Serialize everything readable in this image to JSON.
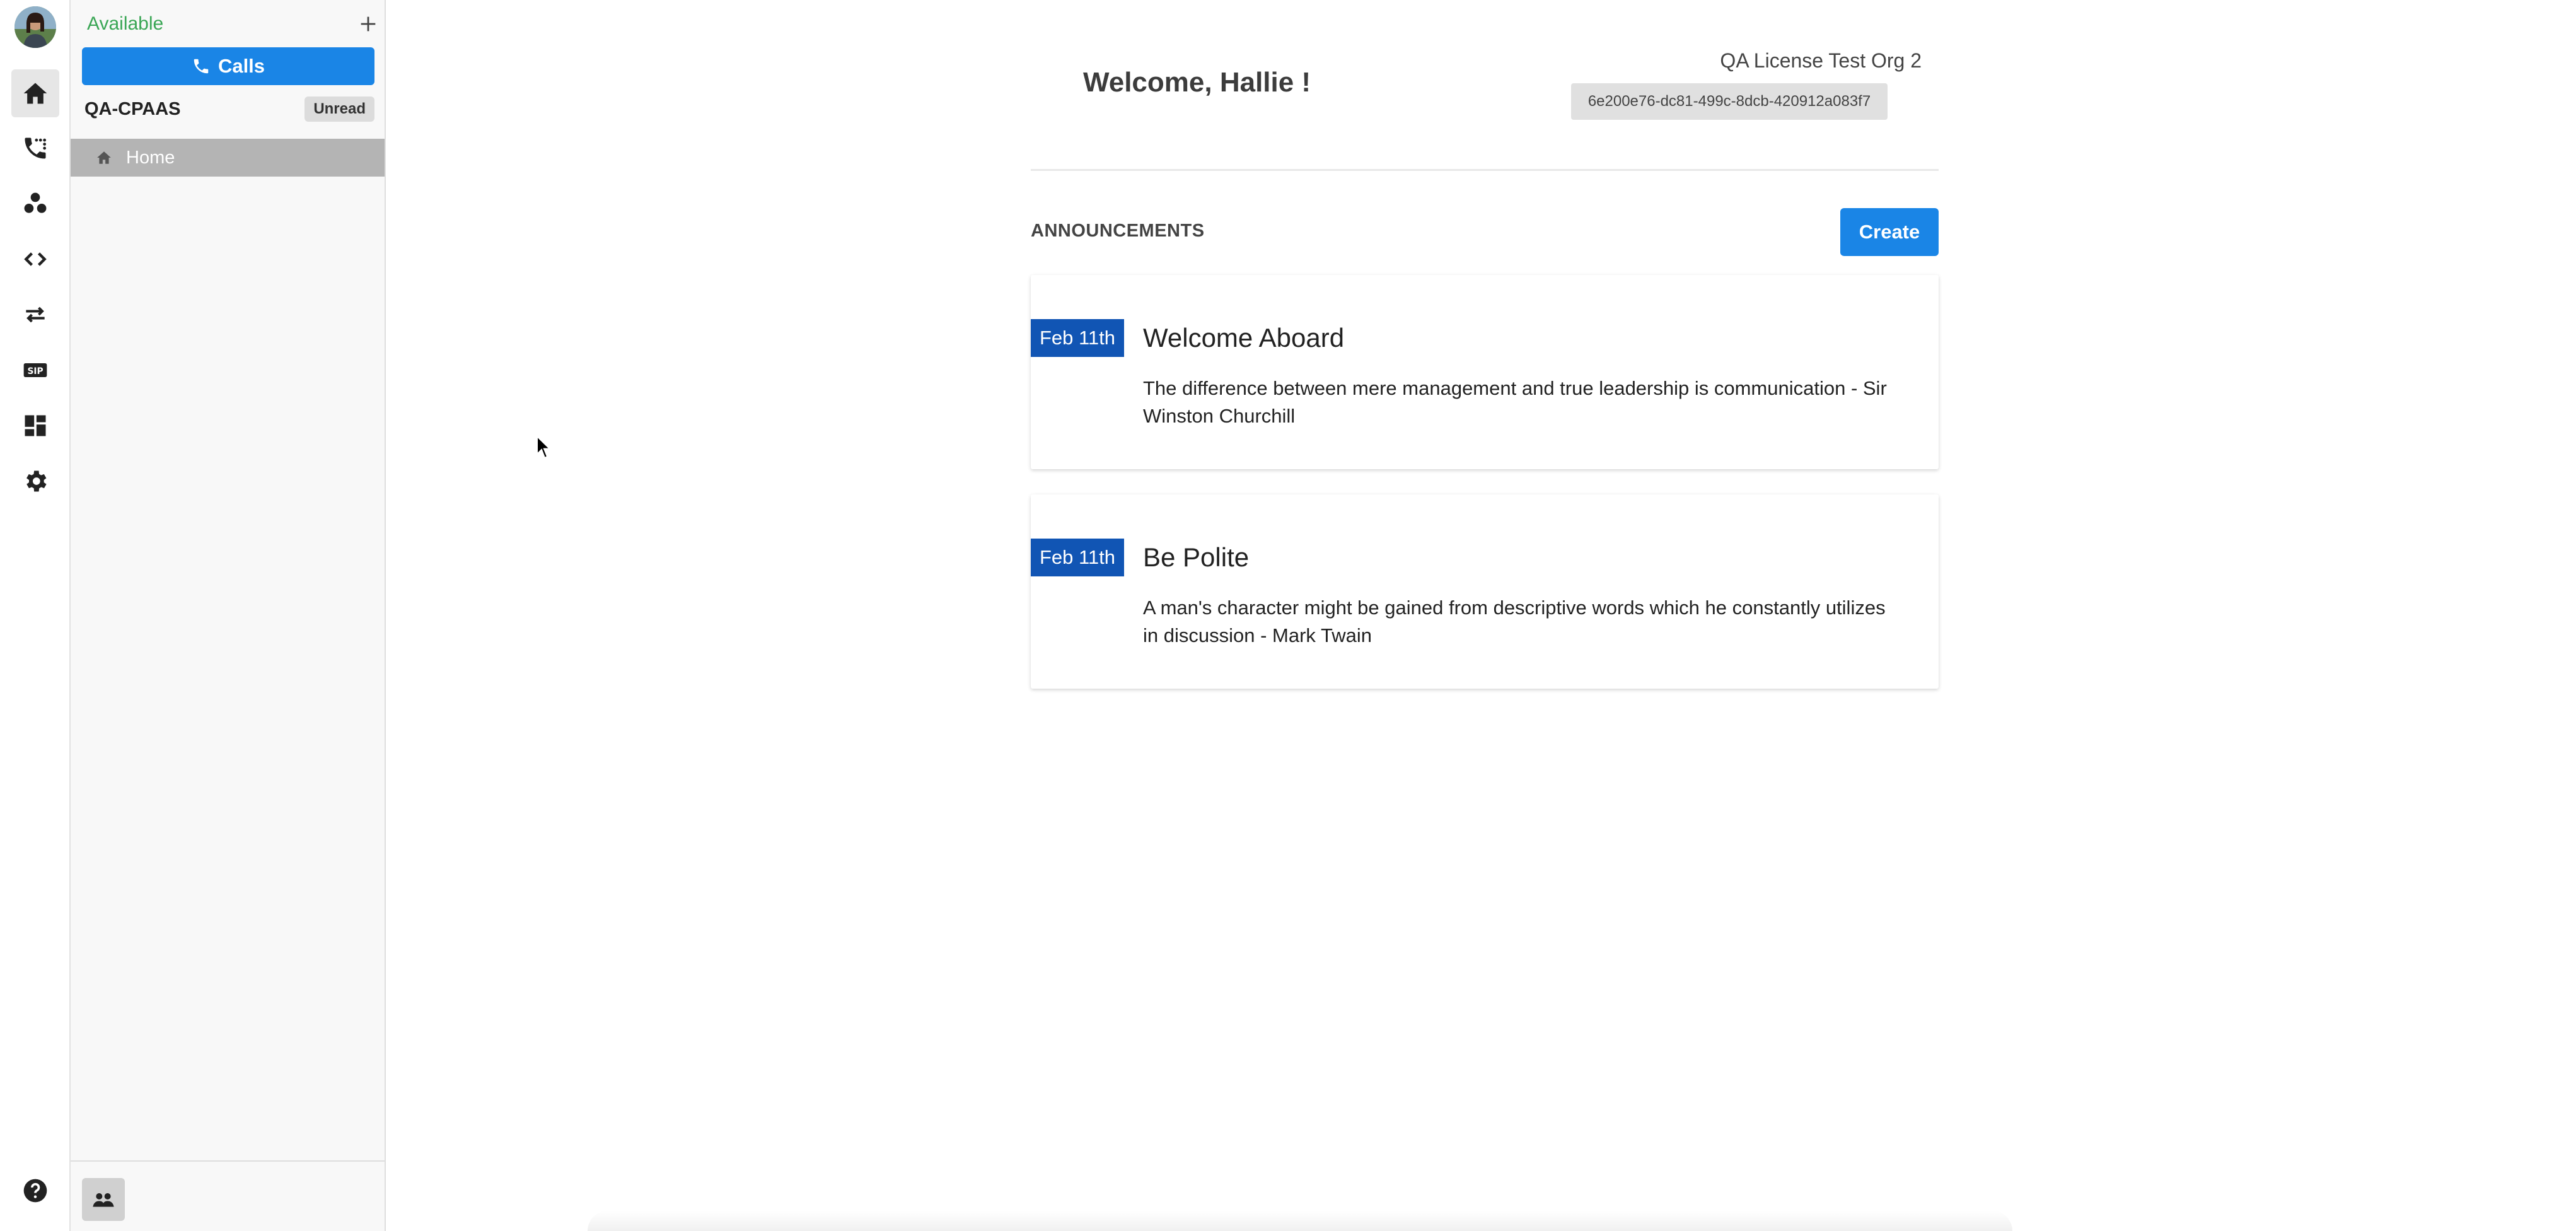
{
  "user": {
    "status": "Available"
  },
  "sidebar": {
    "calls_label": "Calls",
    "org_name": "QA-CPAAS",
    "unread_label": "Unread",
    "home_label": "Home"
  },
  "rail": {
    "items": [
      "home-icon",
      "call-log-icon",
      "contacts-icon",
      "code-icon",
      "transfer-icon",
      "sip-icon",
      "dashboard-icon",
      "settings-icon"
    ],
    "sip_text": "SIP"
  },
  "header": {
    "welcome": "Welcome, Hallie !",
    "org_title": "QA License Test Org 2",
    "org_id": "6e200e76-dc81-499c-8dcb-420912a083f7"
  },
  "announcements": {
    "heading": "ANNOUNCEMENTS",
    "create_label": "Create",
    "items": [
      {
        "date": "Feb 11th",
        "title": "Welcome Aboard",
        "body": "The difference between mere management and true leadership is communication - Sir Winston Churchill"
      },
      {
        "date": "Feb 11th",
        "title": "Be Polite",
        "body": "A man's character might be gained from descriptive words which he constantly utilizes in discussion - Mark Twain"
      }
    ]
  },
  "colors": {
    "accent": "#1a85e6",
    "date_badge": "#1155b4",
    "status_available": "#3aa655"
  }
}
